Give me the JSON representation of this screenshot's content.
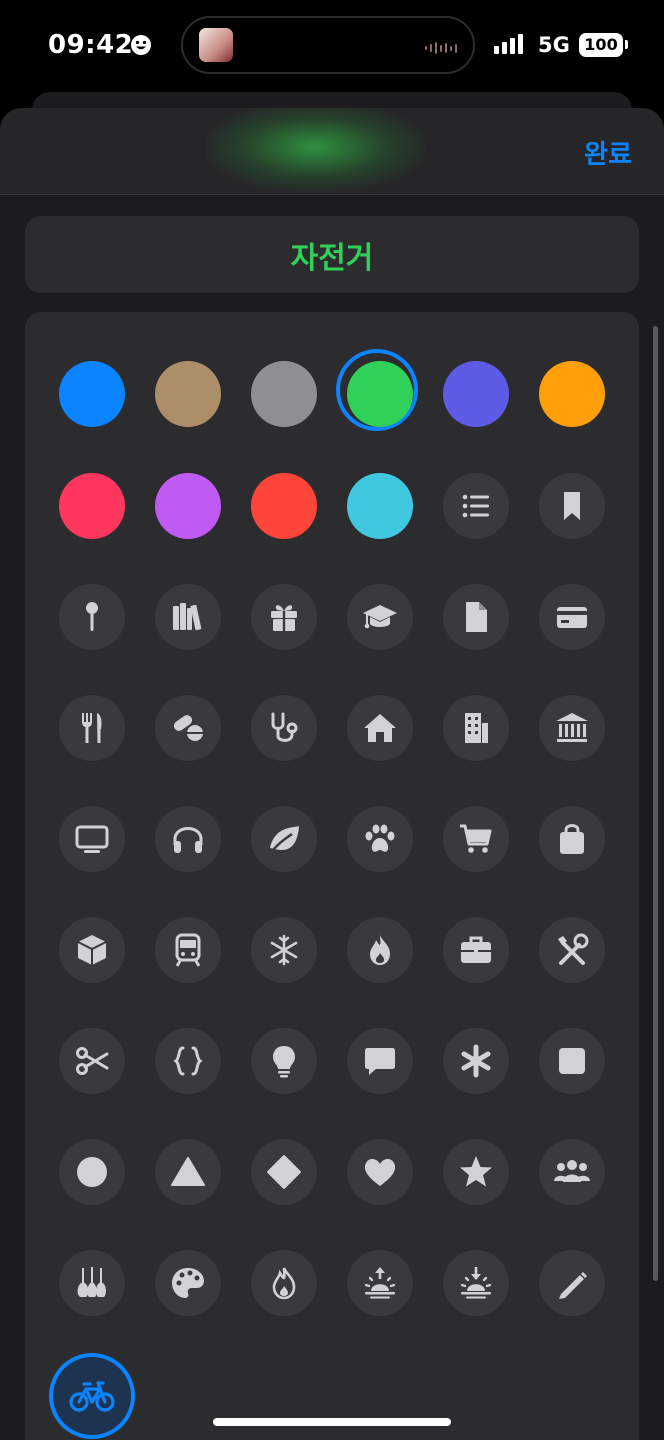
{
  "status_bar": {
    "time": "09:42",
    "network": "5G",
    "battery": "100"
  },
  "header": {
    "done_label": "완료"
  },
  "name_field": {
    "value": "자전거",
    "color": "#30d158"
  },
  "colors": [
    {
      "name": "blue",
      "hex": "#0a84ff",
      "selected": false
    },
    {
      "name": "brown",
      "hex": "#ac8e68",
      "selected": false
    },
    {
      "name": "gray",
      "hex": "#8e8e93",
      "selected": false
    },
    {
      "name": "green",
      "hex": "#30d158",
      "selected": true
    },
    {
      "name": "indigo",
      "hex": "#5e5ce6",
      "selected": false
    },
    {
      "name": "orange",
      "hex": "#ff9f0a",
      "selected": false
    },
    {
      "name": "pink",
      "hex": "#ff375f",
      "selected": false
    },
    {
      "name": "purple",
      "hex": "#bf5af2",
      "selected": false
    },
    {
      "name": "red",
      "hex": "#ff453a",
      "selected": false
    },
    {
      "name": "teal",
      "hex": "#40c8e0",
      "selected": false
    }
  ],
  "icons": [
    "list-icon",
    "bookmark-icon",
    "pin-icon",
    "books-icon",
    "gift-icon",
    "graduation-cap-icon",
    "document-icon",
    "credit-card-icon",
    "fork-knife-icon",
    "pills-icon",
    "stethoscope-icon",
    "house-icon",
    "building-icon",
    "bank-icon",
    "tv-icon",
    "headphones-icon",
    "leaf-icon",
    "paw-icon",
    "cart-icon",
    "bag-icon",
    "box-icon",
    "train-icon",
    "snowflake-icon",
    "flame-icon",
    "briefcase-icon",
    "tools-icon",
    "scissors-icon",
    "braces-icon",
    "lightbulb-icon",
    "speech-bubble-icon",
    "asterisk-icon",
    "square-icon",
    "circle-icon",
    "triangle-icon",
    "diamond-icon",
    "heart-icon",
    "star-icon",
    "people-icon",
    "guitars-icon",
    "palette-icon",
    "flame-outline-icon",
    "sunrise-icon",
    "sunset-icon",
    "pencil-icon"
  ],
  "selected_icon": "bicycle-icon"
}
